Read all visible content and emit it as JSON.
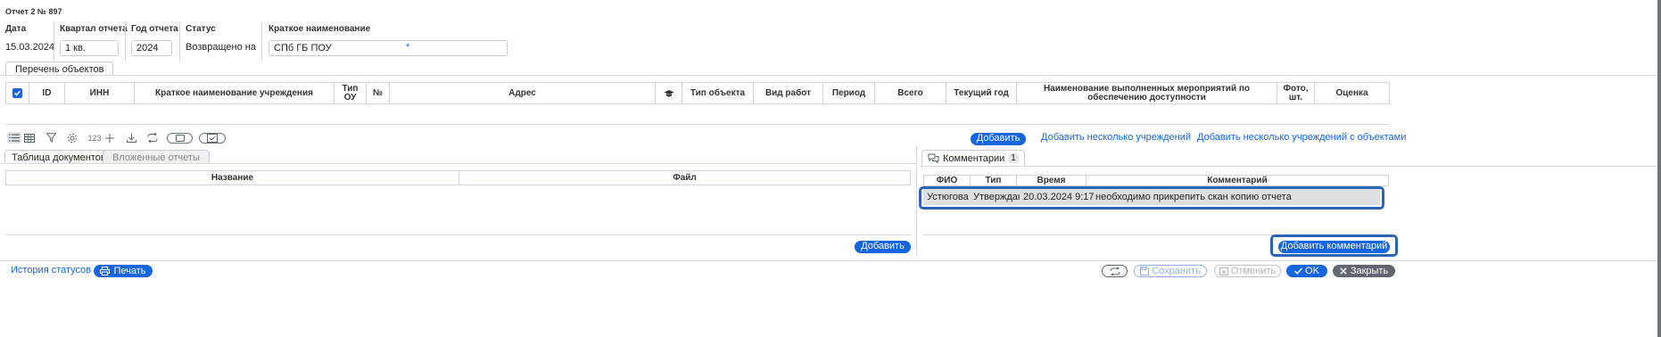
{
  "header": {
    "title": "Отчет 2 № 897"
  },
  "fields": [
    {
      "label": "Дата",
      "value": "15.03.2024"
    },
    {
      "label": "Квартал отчета",
      "value": "1 кв."
    },
    {
      "label": "Год отчета",
      "value": "2024"
    },
    {
      "label": "Статус",
      "value": "Возвращено на д"
    },
    {
      "label": "Краткое наименование",
      "value": "СПб ГБ ПОУ",
      "required_mark": "*"
    }
  ],
  "objects_tab": {
    "label": "Перечень объектов"
  },
  "objects_table": {
    "columns": [
      "ID",
      "ИНН",
      "Краткое наименование учреждения",
      "Тип ОУ",
      "№",
      "Адрес",
      "",
      "Тип объекта",
      "Вид работ",
      "Период",
      "Всего",
      "Текущий год",
      "Наименование выполненных мероприятий по обеспечению доступности",
      "Фото, шт.",
      "Оценка"
    ]
  },
  "toolbar": {
    "icons": [
      "list-view-icon",
      "grid-view-icon",
      "filter-icon",
      "settings-icon",
      "number-format-icon",
      "add-icon",
      "download-icon",
      "refresh-icon",
      "toggle-off-icon",
      "toggle-check-icon"
    ],
    "number_label": "123",
    "add_button": "Добавить",
    "add_multiple_link": "Добавить несколько учреждений",
    "add_multiple_objects_link": "Добавить несколько учреждений с объектами"
  },
  "doc_tabs": [
    {
      "label": "Таблица документов",
      "active": true
    },
    {
      "label": "Вложенные отчеты",
      "active": false
    }
  ],
  "docs_table": {
    "columns": [
      "Название",
      "Файл"
    ],
    "add_button": "Добавить"
  },
  "comments": {
    "tab_label": "Комментарии",
    "count": "1",
    "columns": [
      "ФИО",
      "Тип",
      "Время",
      "Комментарий"
    ],
    "rows": [
      {
        "fio": "Устюгова И",
        "type": "Утверждак",
        "time": "20.03.2024 9:17",
        "comment": "необходимо прикрепить скан копию отчета"
      }
    ],
    "add_button": "Добавить комментарий"
  },
  "footer": {
    "history_link": "История статусов",
    "print_button": "Печать",
    "save_button": "Сохранить",
    "cancel_button": "Отменить",
    "ok_button": "OK",
    "close_button": "Закрыть"
  },
  "colors": {
    "accent": "#1565e0",
    "highlight": "#2a64b8",
    "dark_button": "#5f666e"
  }
}
